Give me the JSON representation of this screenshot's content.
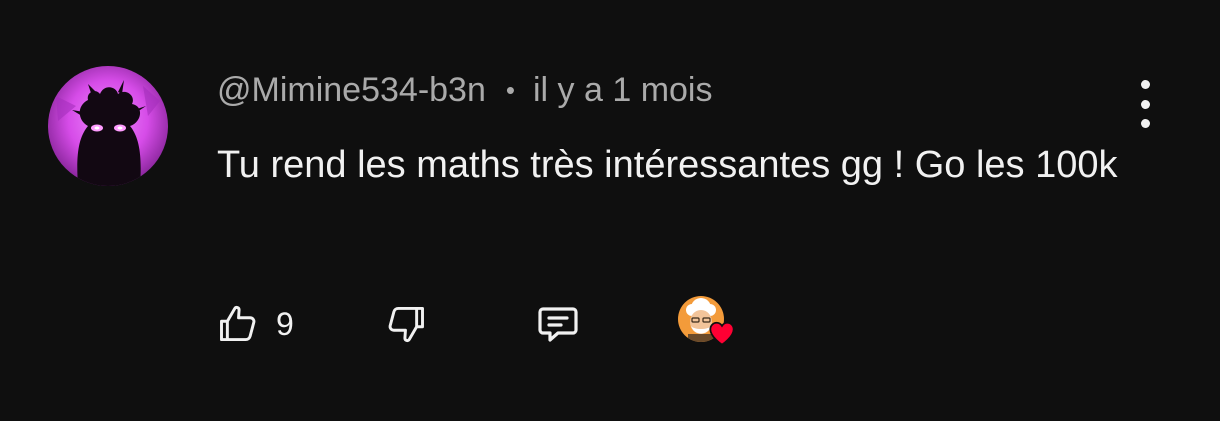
{
  "comment": {
    "author": "@Mimine534-b3n",
    "separator": "•",
    "timestamp": "il y a 1 mois",
    "text": "Tu rend les maths très intéressantes gg ! Go les 100k",
    "avatar_icon": "purple-shadow-creature-avatar",
    "menu_icon": "more-vert-icon"
  },
  "actions": {
    "like_icon": "thumb-up-icon",
    "like_count": "9",
    "dislike_icon": "thumb-down-icon",
    "reply_icon": "reply-comment-icon",
    "creator_heart_icon": "creator-heart-icon"
  },
  "colors": {
    "background": "#0f0f0f",
    "text": "#f1f1f1",
    "secondary_text": "#aaaaaa",
    "heart": "#ff0033",
    "avatar_accent": "#d64ce8"
  }
}
